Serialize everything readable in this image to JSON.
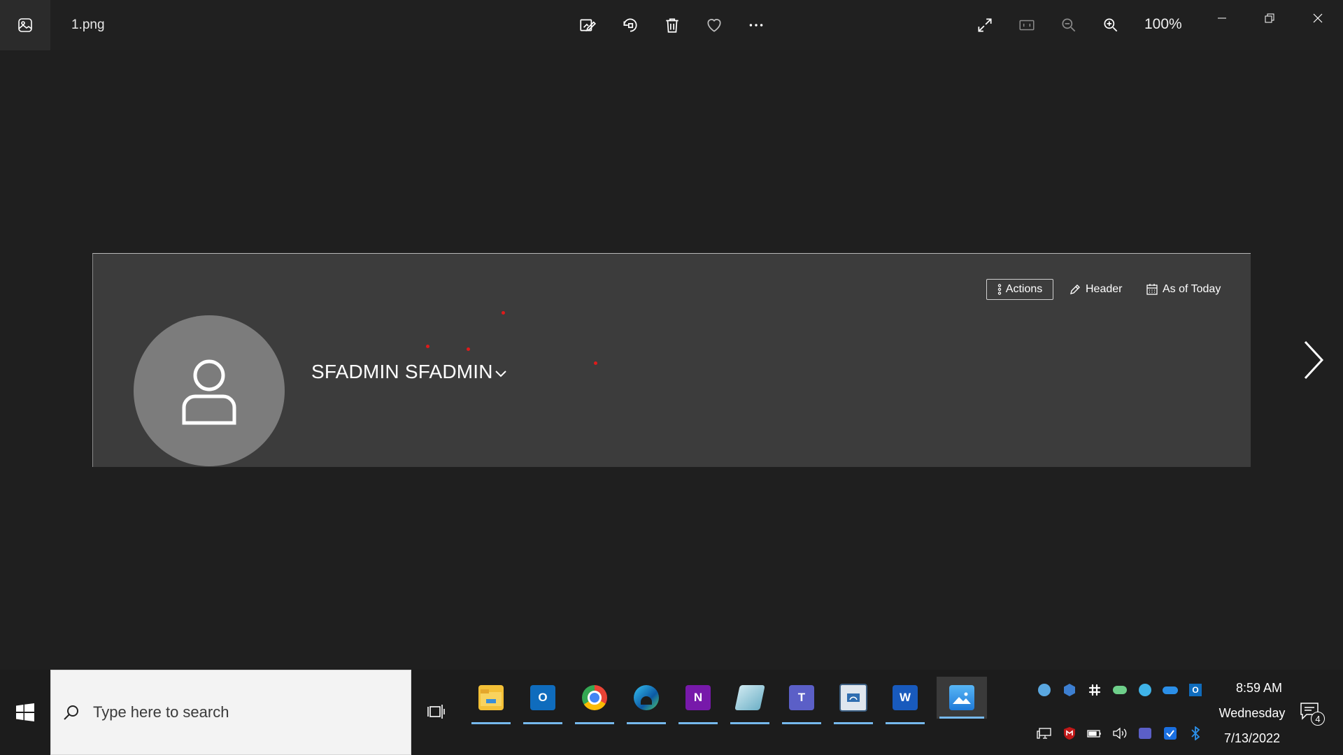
{
  "window": {
    "filename": "1.png",
    "zoom_level": "100%",
    "toolbar_icons": [
      "edit-image-icon",
      "rotate-icon",
      "delete-icon",
      "favorite-icon",
      "more-icon"
    ],
    "view_icons": [
      "full-screen-icon",
      "actual-size-icon",
      "zoom-out-icon",
      "zoom-in-icon"
    ]
  },
  "picture": {
    "user_name": "SFADMIN SFADMIN",
    "actions_label": "Actions",
    "header_label": "Header",
    "as_of_label": "As of Today",
    "background_color": "#3c3c3c",
    "annotation_color": "#e01a1a"
  },
  "taskbar": {
    "search_placeholder": "Type here to search",
    "apps": [
      "file-explorer",
      "outlook",
      "chrome",
      "edge",
      "onenote",
      "mystery-app",
      "teams",
      "remote-desktop",
      "word",
      "photos"
    ],
    "active_app": "photos",
    "clock": {
      "time": "8:59 AM",
      "day": "Wednesday",
      "date": "7/13/2022"
    },
    "notification_count": "4",
    "accent_color": "#76b9ed"
  }
}
